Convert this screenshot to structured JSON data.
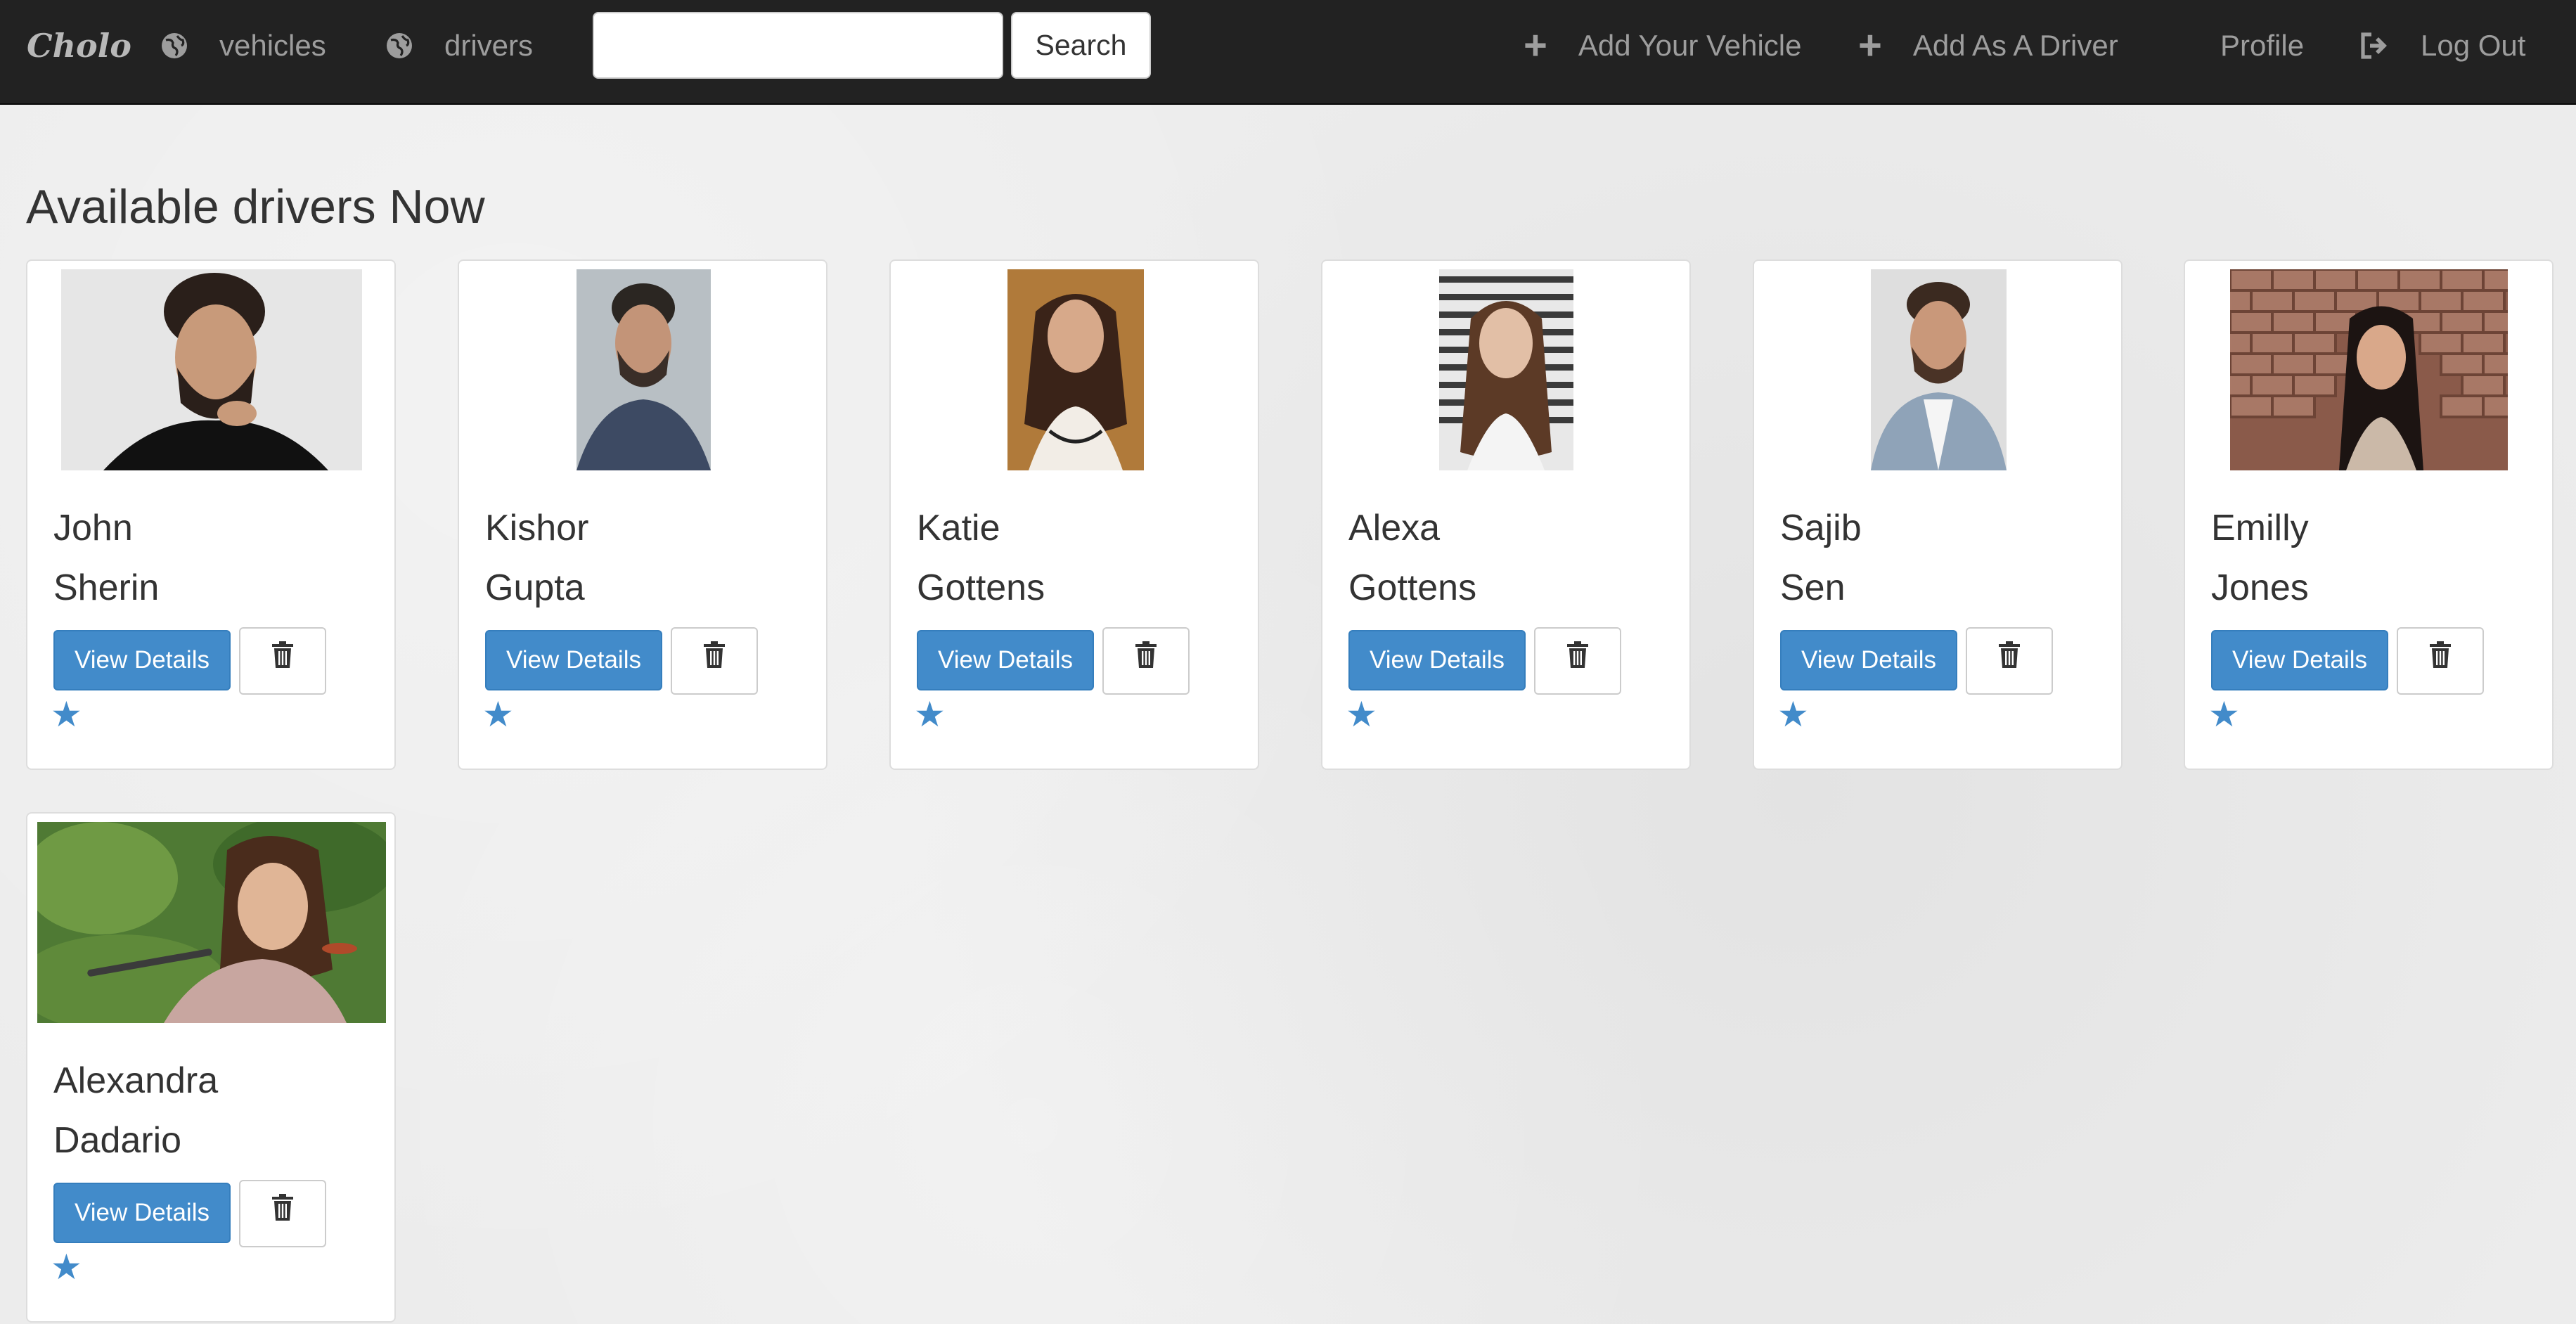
{
  "nav": {
    "brand": "Cholo",
    "vehicles": "vehicles",
    "drivers": "drivers",
    "search_button": "Search",
    "search_value": "",
    "add_vehicle": "Add Your Vehicle",
    "add_driver": "Add As A Driver",
    "profile": "Profile",
    "logout": "Log Out"
  },
  "page": {
    "title": "Available drivers Now"
  },
  "drivers": [
    {
      "first": "John",
      "last": "Sherin",
      "view": "View Details",
      "rating_stars": 1
    },
    {
      "first": "Kishor",
      "last": "Gupta",
      "view": "View Details",
      "rating_stars": 1
    },
    {
      "first": "Katie",
      "last": "Gottens",
      "view": "View Details",
      "rating_stars": 1
    },
    {
      "first": "Alexa",
      "last": "Gottens",
      "view": "View Details",
      "rating_stars": 1
    },
    {
      "first": "Sajib",
      "last": "Sen",
      "view": "View Details",
      "rating_stars": 1
    },
    {
      "first": "Emilly",
      "last": "Jones",
      "view": "View Details",
      "rating_stars": 1
    },
    {
      "first": "Alexandra",
      "last": "Dadario",
      "view": "View Details",
      "rating_stars": 1
    }
  ],
  "colors": {
    "navbar": "#222222",
    "primary_button": "#428bca",
    "star": "#428bca"
  }
}
